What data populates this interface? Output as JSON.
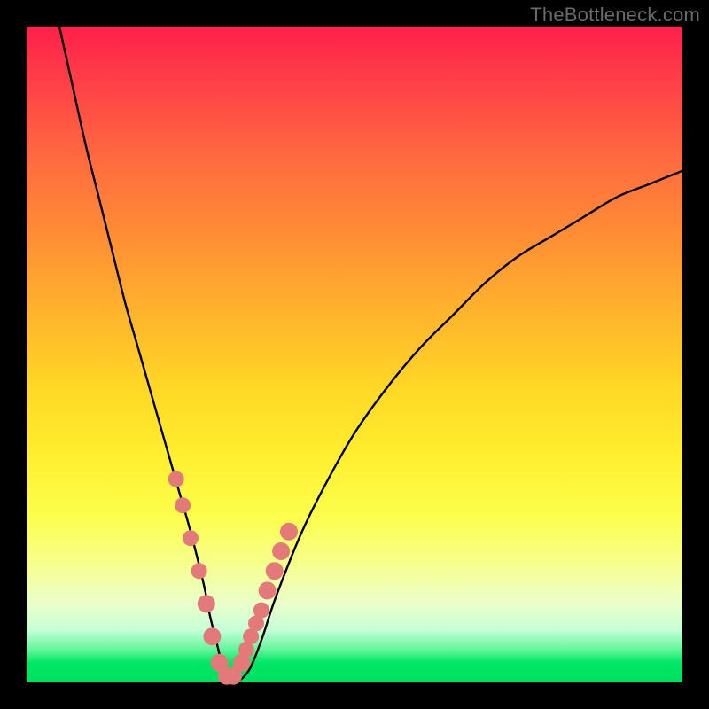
{
  "watermark": "TheBottleneck.com",
  "colors": {
    "frame": "#000000",
    "curve": "#000000",
    "marker": "#e37a79",
    "gradient_top": "#ff1f4b",
    "gradient_bottom": "#00e060"
  },
  "chart_data": {
    "type": "line",
    "title": "",
    "xlabel": "",
    "ylabel": "",
    "xlim": [
      0,
      100
    ],
    "ylim": [
      0,
      100
    ],
    "grid": false,
    "legend": false,
    "series": [
      {
        "name": "bottleneck-curve",
        "x": [
          5,
          7,
          9,
          11,
          13,
          15,
          17,
          19,
          21,
          23,
          25,
          27,
          28,
          29,
          30,
          31,
          32,
          34,
          36,
          38,
          42,
          46,
          50,
          55,
          60,
          65,
          70,
          75,
          80,
          85,
          90,
          95,
          100
        ],
        "y": [
          100,
          91,
          82,
          74,
          66,
          58,
          51,
          44,
          37,
          30,
          23,
          15,
          10,
          6,
          2,
          0,
          0,
          2,
          7,
          13,
          23,
          31,
          38,
          45,
          51,
          56,
          61,
          65,
          68,
          71,
          74,
          76,
          78
        ]
      }
    ],
    "markers": {
      "name": "highlight-dots",
      "x": [
        22.8,
        23.8,
        25.0,
        26.3,
        27.4,
        28.3,
        29.4,
        30.5,
        31.5,
        32.8,
        33.5,
        34.2,
        35.0,
        35.8,
        36.7,
        37.8,
        38.8,
        40.0
      ],
      "y": [
        31,
        27,
        22,
        17,
        12,
        7,
        3,
        1,
        1,
        3,
        5,
        7,
        9,
        11,
        14,
        17,
        20,
        23
      ],
      "r": [
        9,
        9,
        9,
        9,
        10,
        10,
        10,
        10,
        10,
        10,
        9,
        9,
        9,
        9,
        10,
        10,
        10,
        10
      ]
    }
  }
}
